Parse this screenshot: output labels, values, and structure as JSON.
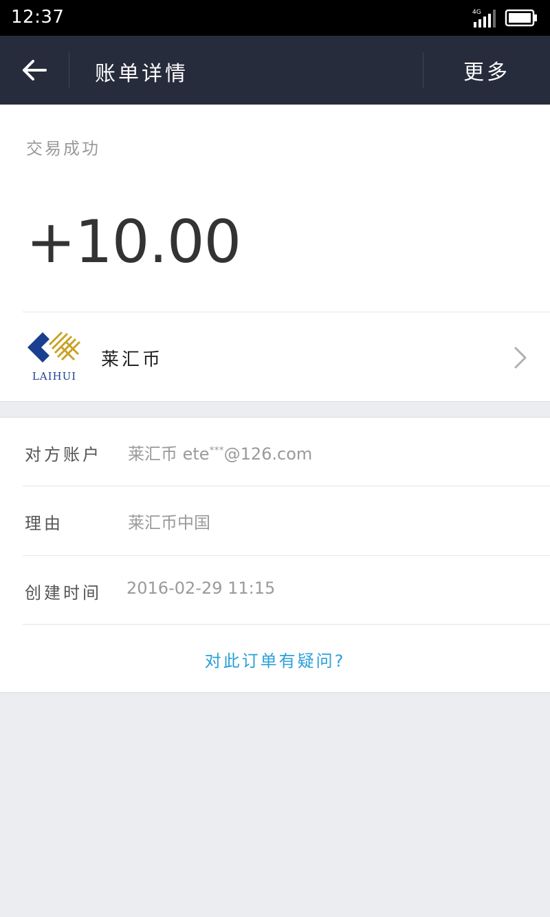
{
  "statusbar": {
    "time": "12:37",
    "network": "4G"
  },
  "navbar": {
    "back_icon": "arrow-left-icon",
    "title": "账单详情",
    "more_label": "更多"
  },
  "transaction": {
    "status": "交易成功",
    "amount": "+10.00"
  },
  "merchant": {
    "logo_text": "LAIHUI",
    "name": "莱汇币",
    "chevron_icon": "chevron-right-icon"
  },
  "details": [
    {
      "label": "对方账户",
      "value_prefix": "莱汇币 ete",
      "value_mask": "***",
      "value_suffix": "@126.com"
    },
    {
      "label": "理由",
      "value": "莱汇币中国"
    },
    {
      "label": "创建时间",
      "value": "2016-02-29 11:15"
    }
  ],
  "question_link": "对此订单有疑问?",
  "colors": {
    "navbar_bg": "#272c3c",
    "link": "#2aa0d8",
    "logo_blue": "#1b3f8f",
    "logo_gold": "#c9a227"
  }
}
